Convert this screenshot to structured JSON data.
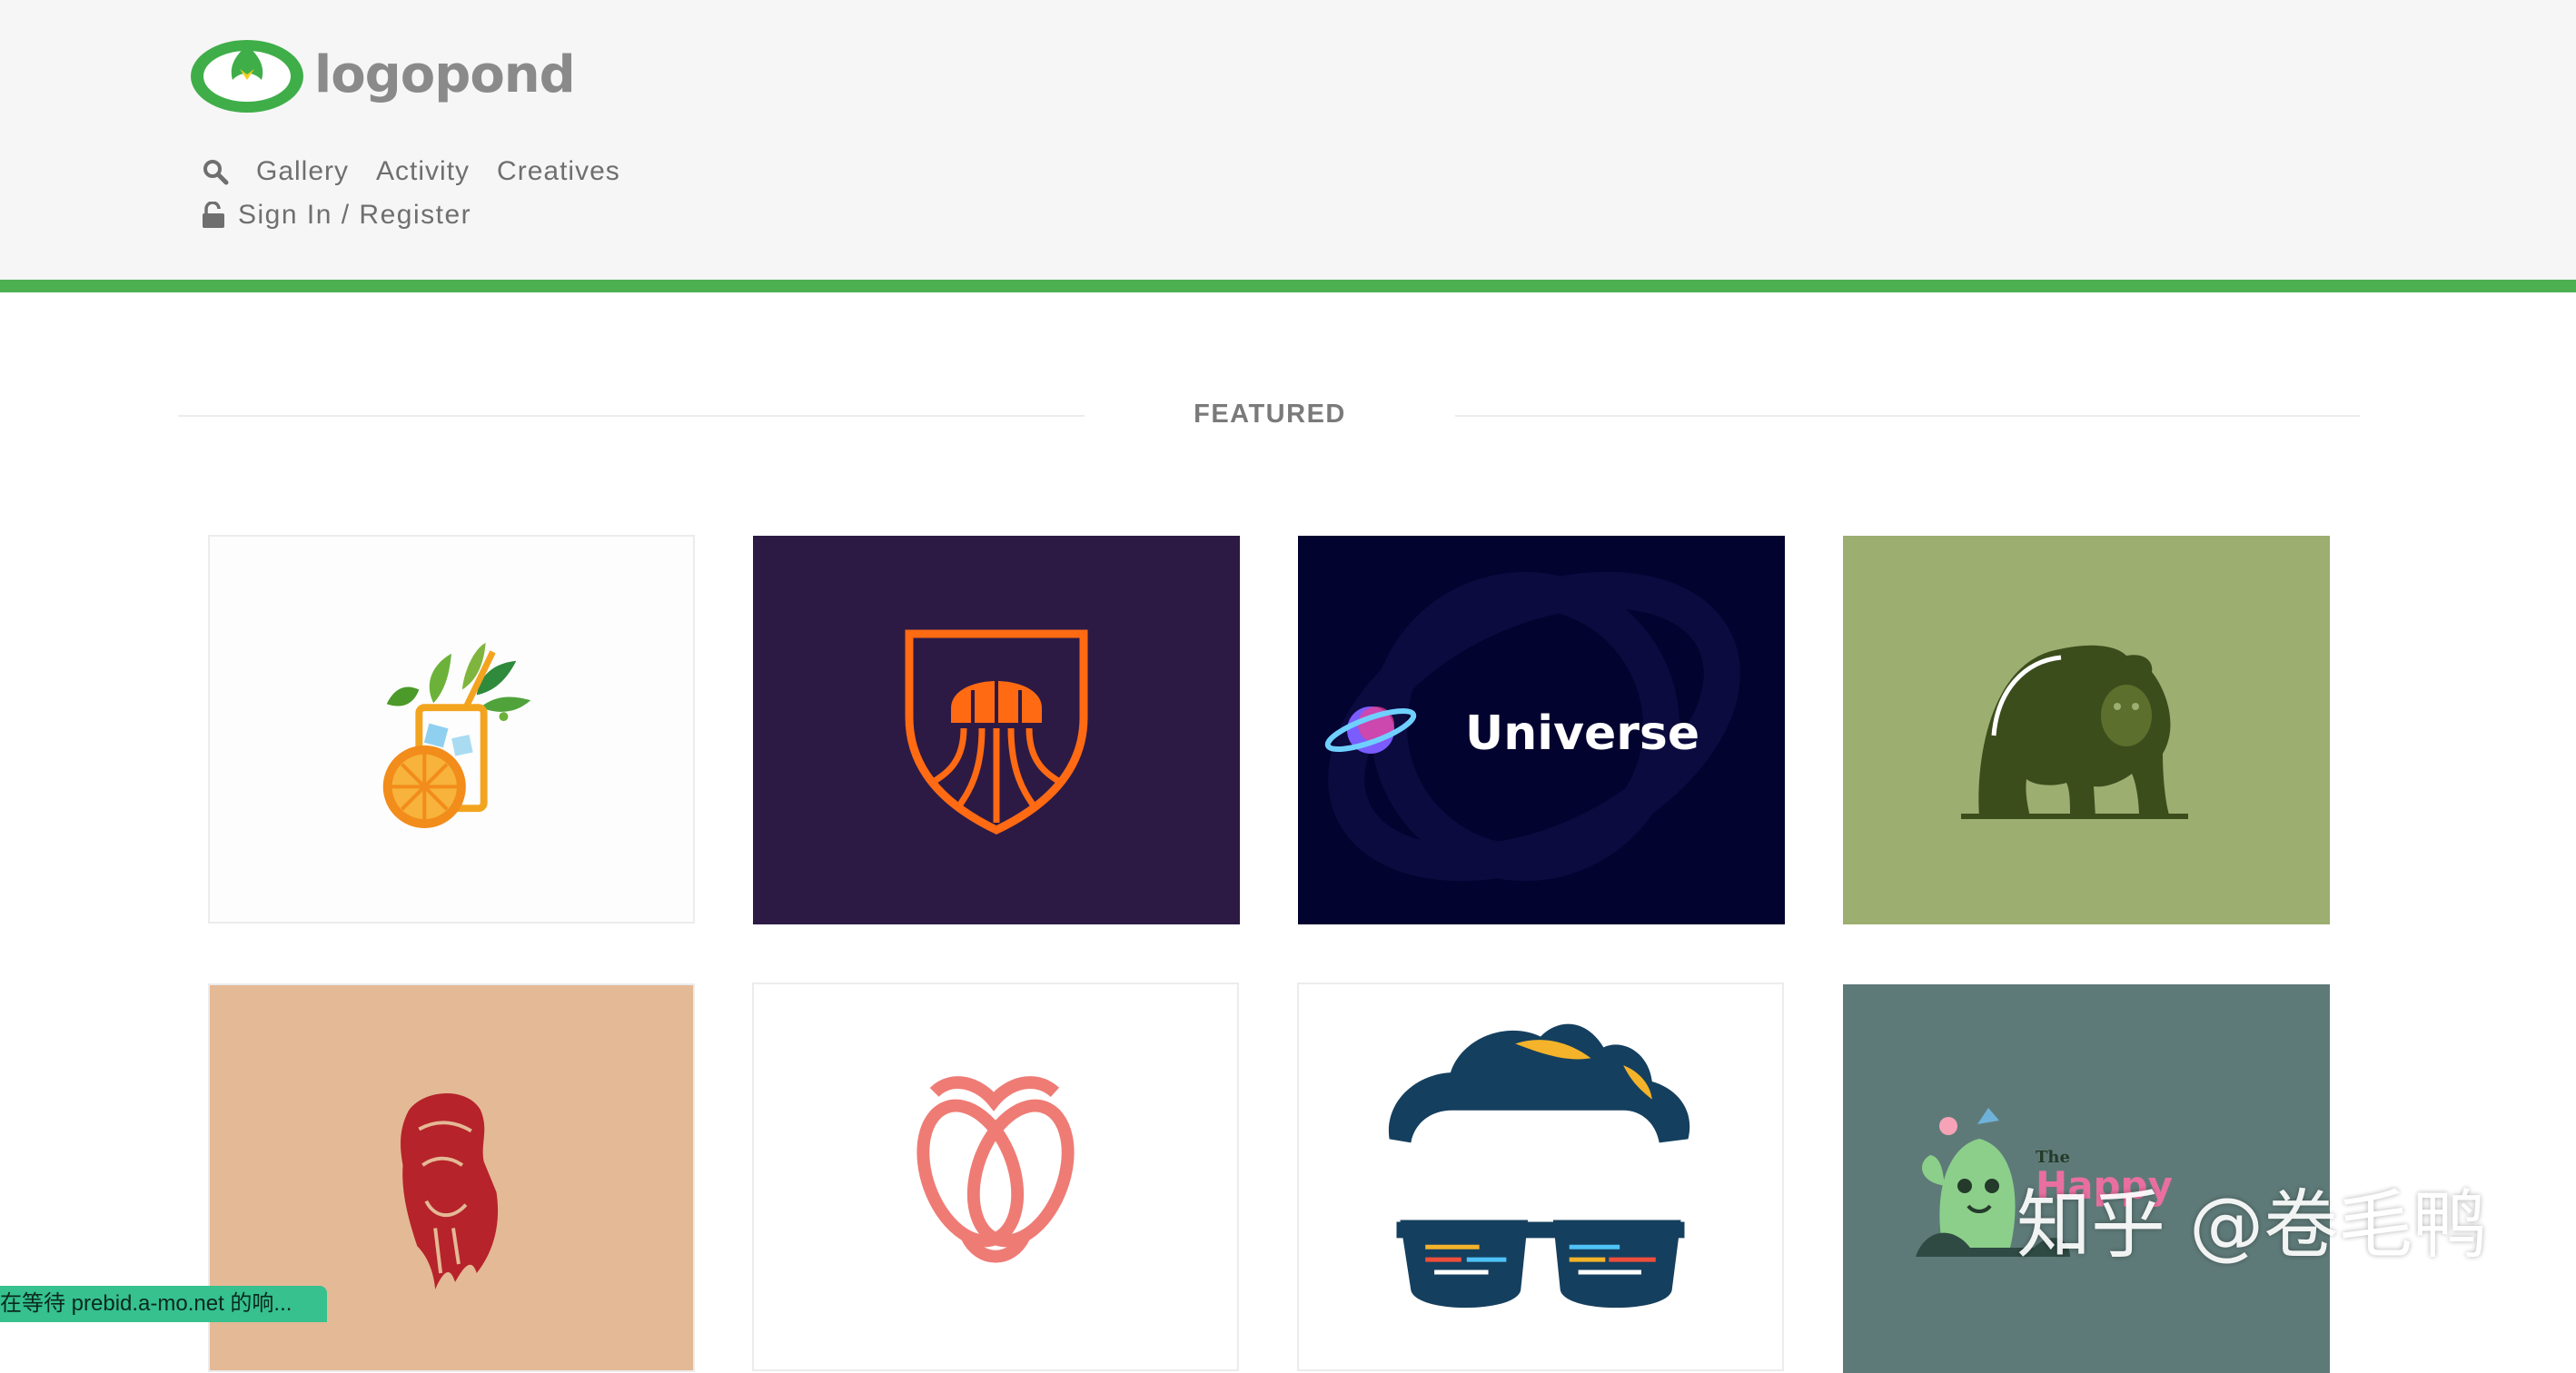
{
  "header": {
    "logo_text": "logopond",
    "nav": [
      {
        "label": "Gallery"
      },
      {
        "label": "Activity"
      },
      {
        "label": "Creatives"
      }
    ],
    "signin_label": "Sign In / Register",
    "accent_color": "#4caf50"
  },
  "featured": {
    "title": "FEATURED",
    "tiles": [
      {
        "name": "drink-logo",
        "text": ""
      },
      {
        "name": "jellyfish-shield-logo",
        "text": ""
      },
      {
        "name": "universe-logo",
        "text": "Universe"
      },
      {
        "name": "bear-logo",
        "text": ""
      },
      {
        "name": "bearded-man-logo",
        "text": ""
      },
      {
        "name": "knot-logo",
        "text": ""
      },
      {
        "name": "coder-glasses-logo",
        "text": ""
      },
      {
        "name": "happy-cactus-logo",
        "text": "The Happy"
      }
    ]
  },
  "status_bar": {
    "text": "在等待 prebid.a-mo.net 的响..."
  },
  "watermark": {
    "text": "知乎 @卷毛鸭"
  }
}
